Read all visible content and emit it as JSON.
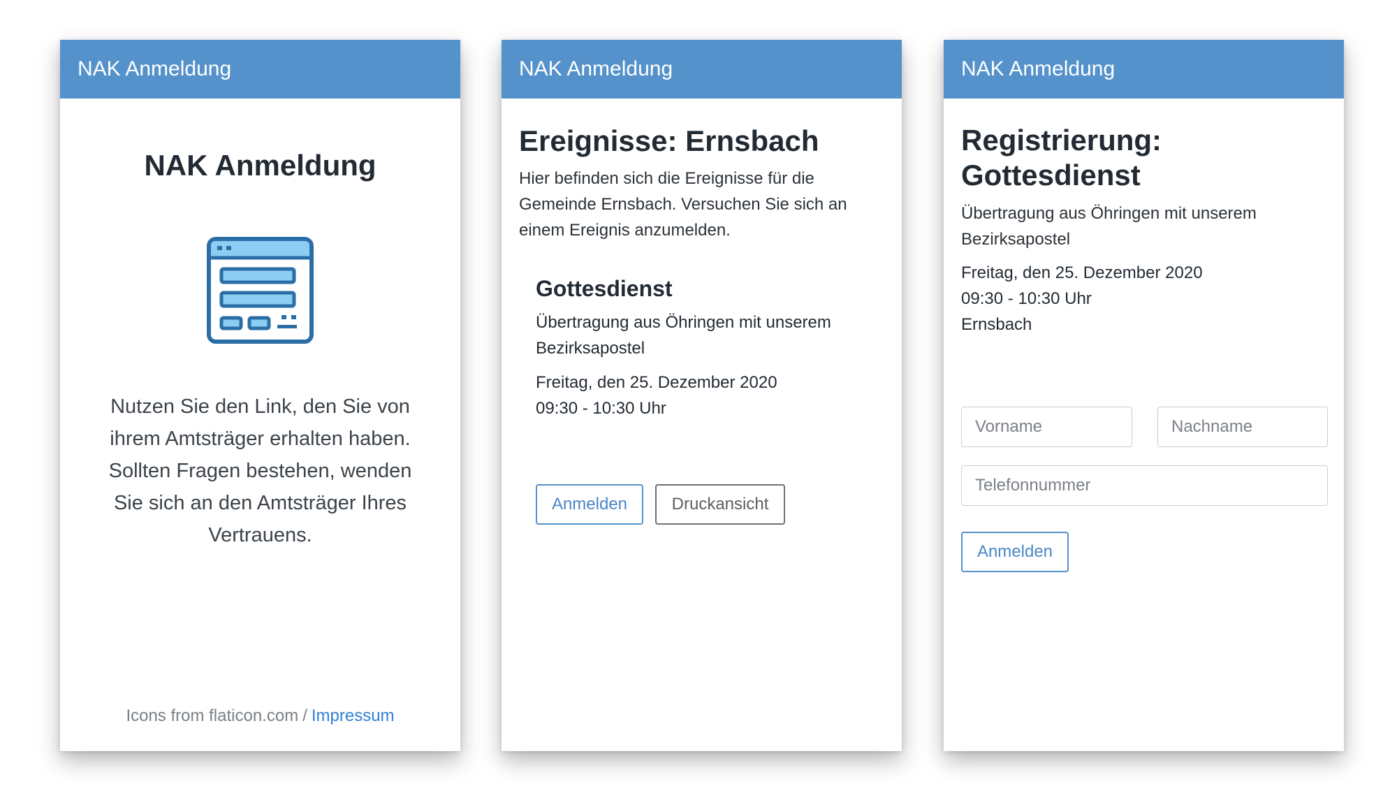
{
  "screens": [
    {
      "navbar_title": "NAK Anmeldung",
      "heading": "NAK Anmeldung",
      "illustration_icon": "browser-window-icon",
      "text": "Nutzen Sie den Link, den Sie von ihrem Amtsträger erhalten haben. Sollten Fragen bestehen, wenden Sie sich an den Amtsträger Ihres Vertrauens.",
      "footer": {
        "credit": "Icons from flaticon.com",
        "separator": "/",
        "link": "Impressum"
      }
    },
    {
      "navbar_title": "NAK Anmeldung",
      "heading": "Ereignisse: Ernsbach",
      "lead": "Hier befinden sich die Ereignisse für die Gemeinde Ernsbach. Versuchen Sie sich an einem Ereignis anzumelden.",
      "event": {
        "title": "Gottesdienst",
        "description": "Übertragung aus Öhringen mit unserem Bezirksapostel",
        "date": "Freitag, den 25. Dezember 2020",
        "time": "09:30 - 10:30 Uhr",
        "register_label": "Anmelden",
        "print_label": "Druckansicht"
      }
    },
    {
      "navbar_title": "NAK Anmeldung",
      "heading_line1": "Registrierung:",
      "heading_line2": "Gottesdienst",
      "lead": "Übertragung aus Öhringen mit unserem Bezirksapostel",
      "date": "Freitag, den 25. Dezember 2020",
      "time": "09:30 - 10:30 Uhr",
      "location": "Ernsbach",
      "form": {
        "firstname_placeholder": "Vorname",
        "lastname_placeholder": "Nachname",
        "phone_placeholder": "Telefonnummer",
        "submit_label": "Anmelden"
      }
    }
  ],
  "colors": {
    "navbar": "#5592cb",
    "primary": "#4a86c5",
    "link": "#2f7fd6",
    "icon_fill": "#8dcdf3",
    "icon_stroke": "#2b6ea6"
  }
}
